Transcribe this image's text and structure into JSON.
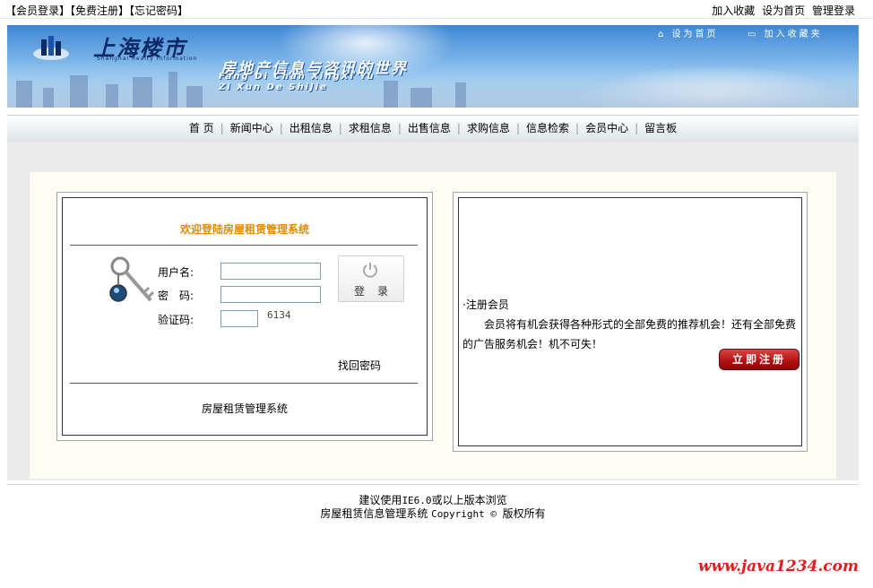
{
  "topbar": {
    "member_login": "【会员登录】",
    "free_register": "【免费注册】",
    "forgot_password": "【忘记密码】",
    "add_favorite": "加入收藏",
    "set_home": "设为首页",
    "admin_login": "管理登录"
  },
  "banner": {
    "logo_text": "上海楼市",
    "logo_sub": "Shanghai Realty Information",
    "slogan": "房地产信息与咨讯的世界",
    "pinyin_line1": "Fang Di Chan XingXi Yu",
    "pinyin_line2": "Zi Xun De ShiJie",
    "set_home": "设为首页",
    "add_favorite": "加入收藏夹"
  },
  "nav": {
    "items": [
      "首 页",
      "新闻中心",
      "出租信息",
      "求租信息",
      "出售信息",
      "求购信息",
      "信息检索",
      "会员中心",
      "留言板"
    ]
  },
  "login": {
    "welcome": "欢迎登陆房屋租赁管理系统",
    "username_label": "用户名:",
    "password_label": "密　码:",
    "captcha_label": "验证码:",
    "captcha_value": "6134",
    "login_button": "登录",
    "find_password": "找回密码",
    "system_name": "房屋租赁管理系统"
  },
  "register": {
    "title": "·注册会员",
    "description": "会员将有机会获得各种形式的全部免费的推荐机会！还有全部免费的广告服务机会！机不可失！",
    "button": "立即注册"
  },
  "footer": {
    "line1_a": "建议使用",
    "line1_b": "IE6.0",
    "line1_c": "或以上版本浏览",
    "line2_a": "房屋租赁信息管理系统",
    "line2_b": "Copyright © ",
    "line2_c": "版权所有"
  },
  "watermark": "www.java1234.com",
  "colors": {
    "welcome": "#e08a00",
    "register_button": "#b01010",
    "watermark": "#e21d1d"
  }
}
